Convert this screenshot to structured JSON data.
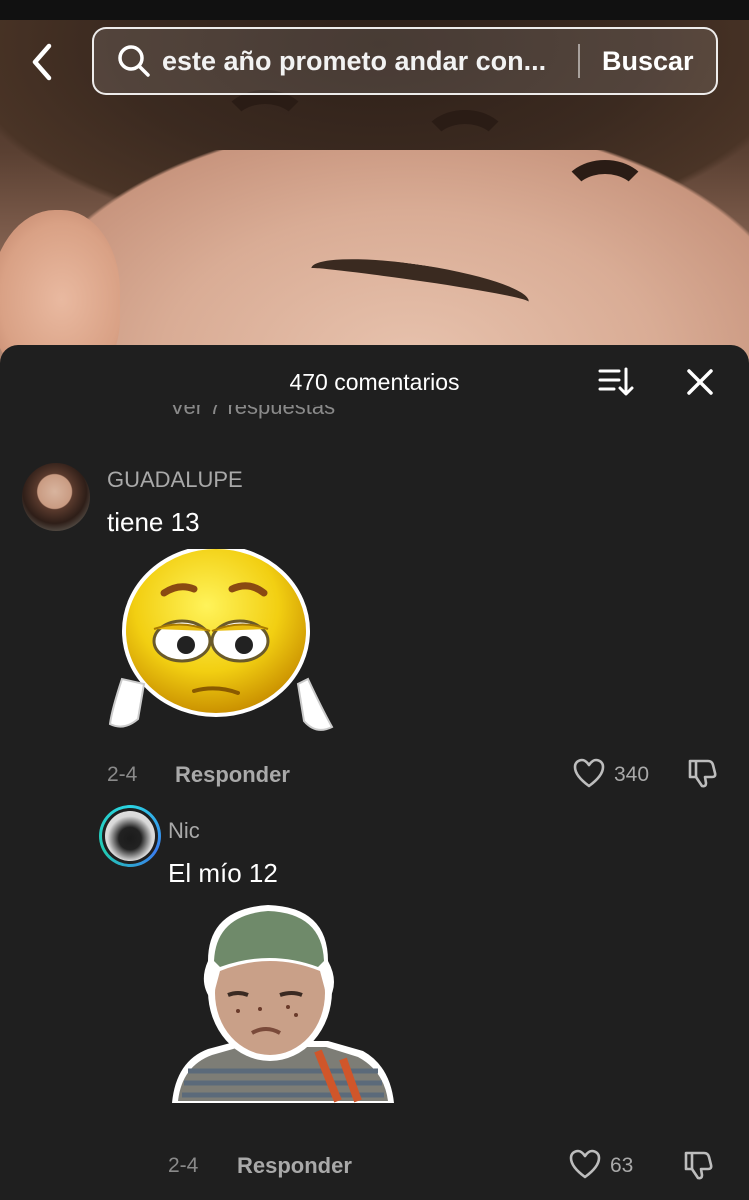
{
  "search": {
    "query": "este año prometo andar con...",
    "button_label": "Buscar"
  },
  "comments_sheet": {
    "title": "470 comentarios",
    "partial_reply_text": "Ver 7 respuestas"
  },
  "comments": [
    {
      "username": "GUADALUPE",
      "text": "tiene 13",
      "sticker": "crying-emoji-sticker",
      "date": "2-4",
      "reply_label": "Responder",
      "likes": "340"
    },
    {
      "username": "Nic",
      "text": "El mío 12",
      "sticker": "chavo-sticker",
      "date": "2-4",
      "reply_label": "Responder",
      "likes": "63"
    }
  ],
  "colors": {
    "sheet_bg": "#1f1f1f",
    "muted_text": "#a9a9a9",
    "avatar_ring": "#2ad4e2"
  }
}
